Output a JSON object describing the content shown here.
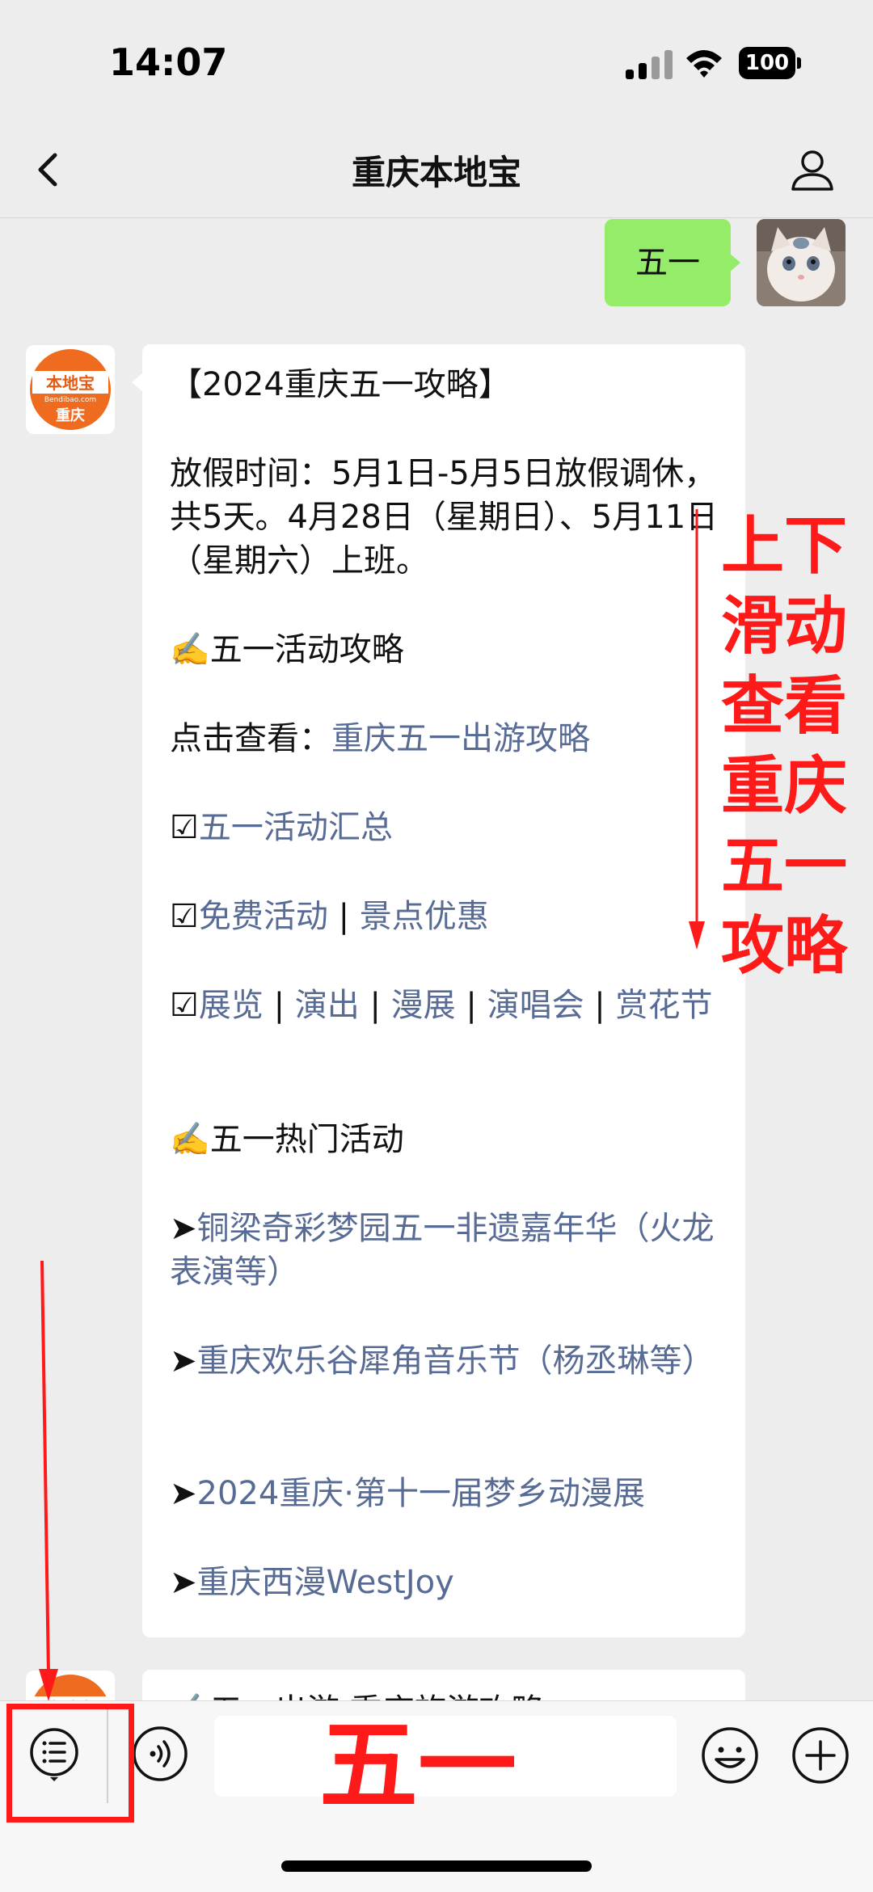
{
  "status_bar": {
    "time": "14:07",
    "battery": "100"
  },
  "nav": {
    "title": "重庆本地宝"
  },
  "outgoing_message": {
    "text": "五一"
  },
  "bot_avatar": {
    "top": "本地宝",
    "domain": "Bendibao.com",
    "city": "重庆"
  },
  "message": {
    "title": "【2024重庆五一攻略】",
    "holiday": "放假时间：5月1日-5月5日放假调休，共5天。4月28日（星期日）、5月11日（星期六）上班。",
    "section1": "✍️五一活动攻略",
    "click_prefix": "点击查看：",
    "click_link": "重庆五一出游攻略",
    "check_mark": "☑",
    "summary_link": "五一活动汇总",
    "free_link": "免费活动",
    "sep": " | ",
    "scenic_link": "景点优惠",
    "exhibit_links": [
      "展览",
      "演出",
      "漫展",
      "演唱会",
      "赏花节"
    ],
    "section2": "✍️五一热门活动",
    "arrow": "➤",
    "hot_events": [
      "铜梁奇彩梦园五一非遗嘉年华（火龙表演等）",
      "重庆欢乐谷犀角音乐节（杨丞琳等）",
      "2024重庆·第十一届梦乡动漫展",
      "重庆西漫WestJoy"
    ],
    "next_preview": "✍️五一出游 重庆旅游攻略"
  },
  "annotations": {
    "scroll_hint": "上下滑动查看重庆五一攻略",
    "input_hint": "五一",
    "color": "#ff1a1a"
  },
  "colors": {
    "link": "#576b95",
    "outgoing": "#95ec69",
    "background": "#ededed"
  }
}
